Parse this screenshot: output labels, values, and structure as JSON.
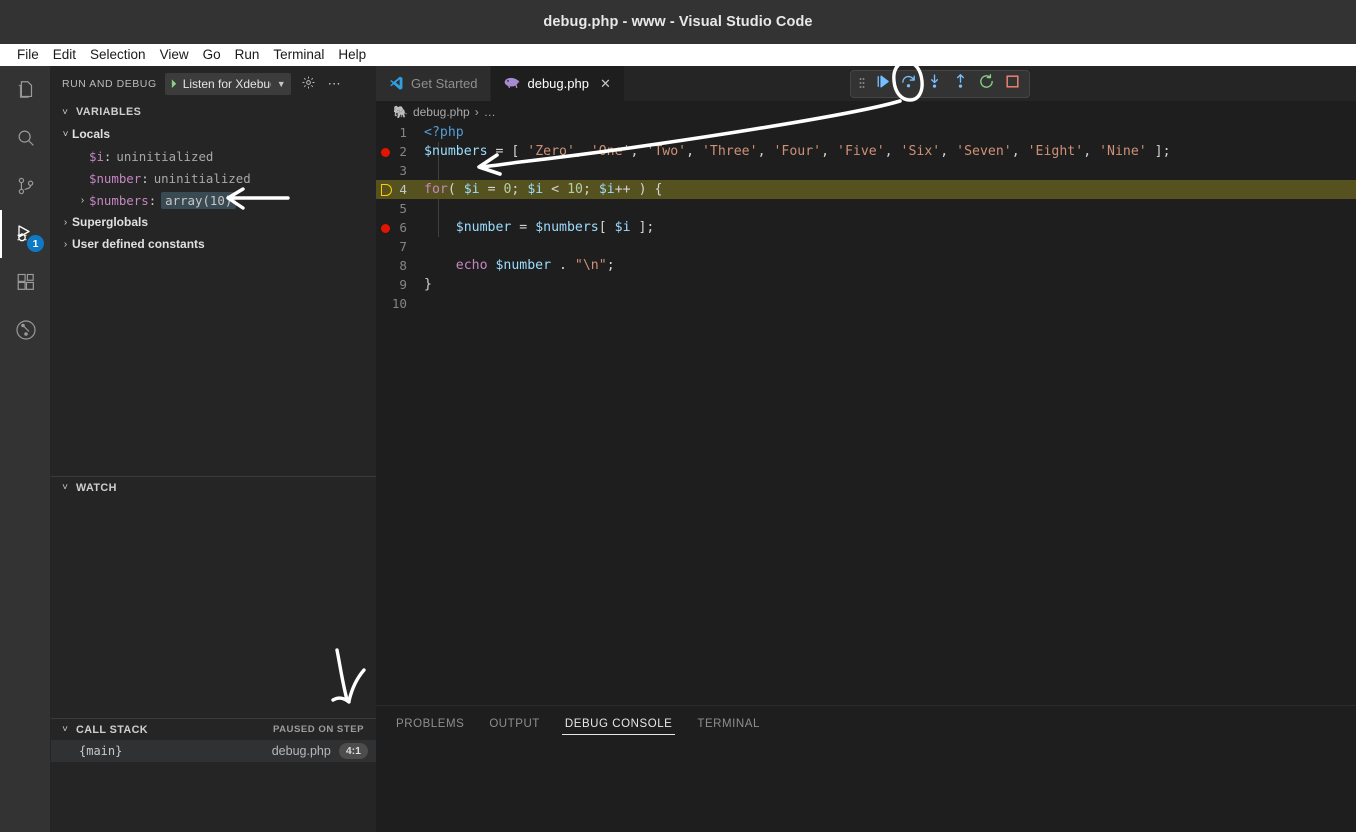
{
  "window": {
    "title": "debug.php - www - Visual Studio Code"
  },
  "menubar": {
    "items": [
      "File",
      "Edit",
      "Selection",
      "View",
      "Go",
      "Run",
      "Terminal",
      "Help"
    ]
  },
  "activitybar": {
    "items": [
      {
        "name": "explorer",
        "icon": "files-icon",
        "active": false,
        "badge": ""
      },
      {
        "name": "search",
        "icon": "search-icon",
        "active": false,
        "badge": ""
      },
      {
        "name": "source-control",
        "icon": "source-control-icon",
        "active": false,
        "badge": ""
      },
      {
        "name": "run-and-debug",
        "icon": "run-and-debug-icon",
        "active": true,
        "badge": "1"
      },
      {
        "name": "extensions",
        "icon": "extensions-icon",
        "active": false,
        "badge": ""
      },
      {
        "name": "testing",
        "icon": "testing-beaker-icon",
        "active": false,
        "badge": ""
      }
    ]
  },
  "sidebar": {
    "title": "RUN AND DEBUG",
    "config": {
      "label": "Listen for Xdebug",
      "play_icon": "play-icon",
      "chevron_icon": "chevron-down-icon"
    },
    "gear_icon": "gear-icon",
    "more_icon": "ellipsis-icon",
    "variables": {
      "title": "VARIABLES",
      "rows": [
        {
          "indent": 1,
          "twisty": "expanded",
          "label": "Locals",
          "type": "group"
        },
        {
          "indent": 2,
          "twisty": "none",
          "key": "$i",
          "value": "uninitialized",
          "type": "var"
        },
        {
          "indent": 2,
          "twisty": "none",
          "key": "$number",
          "value": "uninitialized",
          "type": "var"
        },
        {
          "indent": 2,
          "twisty": "collapsed",
          "key": "$numbers",
          "value": "array(10)",
          "type": "var",
          "pill": true
        },
        {
          "indent": 1,
          "twisty": "collapsed",
          "label": "Superglobals",
          "type": "group"
        },
        {
          "indent": 1,
          "twisty": "collapsed",
          "label": "User defined constants",
          "type": "group"
        }
      ]
    },
    "watch": {
      "title": "WATCH"
    },
    "callstack": {
      "title": "CALL STACK",
      "status": "PAUSED ON STEP",
      "rows": [
        {
          "name": "{main}",
          "file": "debug.php",
          "position": "4:1"
        }
      ]
    }
  },
  "editor": {
    "tabs": [
      {
        "label": "Get Started",
        "icon": "vscode-logo-icon",
        "active": false,
        "closable": false
      },
      {
        "label": "debug.php",
        "icon": "php-elephant-icon",
        "active": true,
        "closable": true
      }
    ],
    "close_glyph": "✕",
    "breadcrumb": {
      "file": "debug.php",
      "separator": "›",
      "more": "…"
    },
    "lines": [
      {
        "num": "1",
        "breakpoint": false,
        "pointer": false,
        "current": false,
        "tokens": [
          {
            "t": "tag",
            "s": "<?php"
          }
        ]
      },
      {
        "num": "2",
        "breakpoint": true,
        "pointer": false,
        "current": false,
        "tokens": [
          {
            "t": "var",
            "s": "$numbers"
          },
          {
            "t": "pln",
            "s": " "
          },
          {
            "t": "op",
            "s": "="
          },
          {
            "t": "pln",
            "s": " ["
          },
          {
            "t": "str",
            "s": " 'Zero'"
          },
          {
            "t": "pln",
            "s": ","
          },
          {
            "t": "str",
            "s": " 'One'"
          },
          {
            "t": "pln",
            "s": ","
          },
          {
            "t": "str",
            "s": " 'Two'"
          },
          {
            "t": "pln",
            "s": ","
          },
          {
            "t": "str",
            "s": " 'Three'"
          },
          {
            "t": "pln",
            "s": ","
          },
          {
            "t": "str",
            "s": " 'Four'"
          },
          {
            "t": "pln",
            "s": ","
          },
          {
            "t": "str",
            "s": " 'Five'"
          },
          {
            "t": "pln",
            "s": ","
          },
          {
            "t": "str",
            "s": " 'Six'"
          },
          {
            "t": "pln",
            "s": ","
          },
          {
            "t": "str",
            "s": " 'Seven'"
          },
          {
            "t": "pln",
            "s": ","
          },
          {
            "t": "str",
            "s": " 'Eight'"
          },
          {
            "t": "pln",
            "s": ","
          },
          {
            "t": "str",
            "s": " 'Nine'"
          },
          {
            "t": "pln",
            "s": " ];"
          }
        ]
      },
      {
        "num": "3",
        "breakpoint": false,
        "pointer": false,
        "current": false,
        "tokens": []
      },
      {
        "num": "4",
        "breakpoint": false,
        "pointer": true,
        "current": true,
        "tokens": [
          {
            "t": "kw",
            "s": "for"
          },
          {
            "t": "pln",
            "s": "( "
          },
          {
            "t": "var",
            "s": "$i"
          },
          {
            "t": "pln",
            "s": " "
          },
          {
            "t": "op",
            "s": "="
          },
          {
            "t": "pln",
            "s": " "
          },
          {
            "t": "num",
            "s": "0"
          },
          {
            "t": "pln",
            "s": "; "
          },
          {
            "t": "var",
            "s": "$i"
          },
          {
            "t": "pln",
            "s": " "
          },
          {
            "t": "op",
            "s": "<"
          },
          {
            "t": "pln",
            "s": " "
          },
          {
            "t": "num",
            "s": "10"
          },
          {
            "t": "pln",
            "s": "; "
          },
          {
            "t": "var",
            "s": "$i"
          },
          {
            "t": "op",
            "s": "++"
          },
          {
            "t": "pln",
            "s": " ) {"
          }
        ]
      },
      {
        "num": "5",
        "breakpoint": false,
        "pointer": false,
        "current": false,
        "tokens": []
      },
      {
        "num": "6",
        "breakpoint": true,
        "pointer": false,
        "current": false,
        "tokens": [
          {
            "t": "pln",
            "s": "    "
          },
          {
            "t": "var",
            "s": "$number"
          },
          {
            "t": "pln",
            "s": " "
          },
          {
            "t": "op",
            "s": "="
          },
          {
            "t": "pln",
            "s": " "
          },
          {
            "t": "var",
            "s": "$numbers"
          },
          {
            "t": "pln",
            "s": "[ "
          },
          {
            "t": "var",
            "s": "$i"
          },
          {
            "t": "pln",
            "s": " ];"
          }
        ]
      },
      {
        "num": "7",
        "breakpoint": false,
        "pointer": false,
        "current": false,
        "tokens": []
      },
      {
        "num": "8",
        "breakpoint": false,
        "pointer": false,
        "current": false,
        "tokens": [
          {
            "t": "pln",
            "s": "    "
          },
          {
            "t": "kw",
            "s": "echo"
          },
          {
            "t": "pln",
            "s": " "
          },
          {
            "t": "var",
            "s": "$number"
          },
          {
            "t": "pln",
            "s": " "
          },
          {
            "t": "op",
            "s": "."
          },
          {
            "t": "pln",
            "s": " "
          },
          {
            "t": "str",
            "s": "\"\\n\""
          },
          {
            "t": "pln",
            "s": ";"
          }
        ]
      },
      {
        "num": "9",
        "breakpoint": false,
        "pointer": false,
        "current": false,
        "tokens": [
          {
            "t": "pln",
            "s": "}"
          }
        ]
      },
      {
        "num": "10",
        "breakpoint": false,
        "pointer": false,
        "current": false,
        "tokens": []
      }
    ]
  },
  "debug_toolbar": {
    "buttons": [
      {
        "name": "drag-handle",
        "icon": "grip-dots-icon",
        "label": "",
        "color": "#8a8a8a"
      },
      {
        "name": "continue-button",
        "icon": "continue-icon",
        "label": "Continue",
        "color": "#75beff"
      },
      {
        "name": "step-over-button",
        "icon": "step-over-icon",
        "label": "Step Over",
        "color": "#75beff",
        "highlighted": true
      },
      {
        "name": "step-into-button",
        "icon": "step-into-icon",
        "label": "Step Into",
        "color": "#75beff"
      },
      {
        "name": "step-out-button",
        "icon": "step-out-icon",
        "label": "Step Out",
        "color": "#75beff"
      },
      {
        "name": "restart-button",
        "icon": "restart-icon",
        "label": "Restart",
        "color": "#89d185"
      },
      {
        "name": "stop-button",
        "icon": "stop-icon",
        "label": "Stop",
        "color": "#f48771"
      }
    ]
  },
  "panel": {
    "tabs": [
      {
        "label": "PROBLEMS",
        "active": false
      },
      {
        "label": "OUTPUT",
        "active": false
      },
      {
        "label": "DEBUG CONSOLE",
        "active": true
      },
      {
        "label": "TERMINAL",
        "active": false
      }
    ]
  },
  "annotations": {
    "color": "#ffffff",
    "items": [
      {
        "name": "circle-around-step-over",
        "shape": "ellipse"
      },
      {
        "name": "arrow-from-step-over-to-code",
        "shape": "long-arrow-left-down"
      },
      {
        "name": "arrow-pointing-at-numbers-variable",
        "shape": "arrow-left"
      },
      {
        "name": "arrow-pointing-down-to-debug-console",
        "shape": "arrow-down"
      }
    ]
  }
}
